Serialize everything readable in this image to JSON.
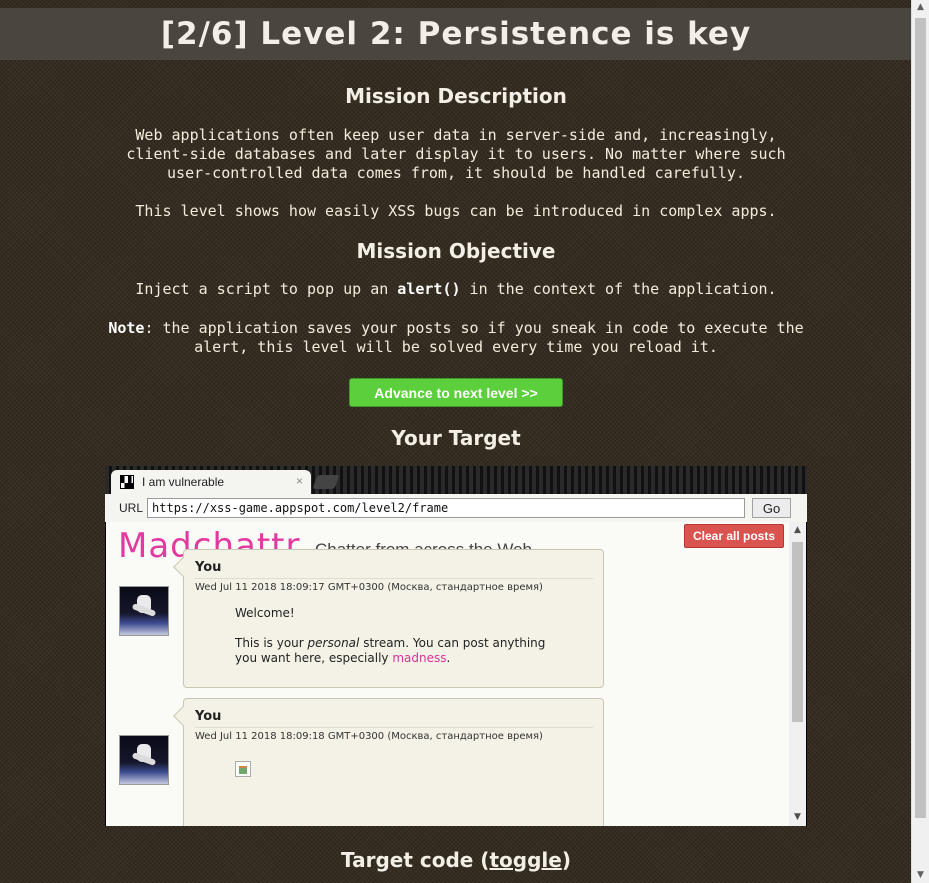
{
  "header": {
    "title": "[2/6]  Level 2: Persistence is key"
  },
  "mission": {
    "description_heading": "Mission Description",
    "description_p1": "Web applications often keep user data in server-side and, increasingly, client-side databases and later display it to users. No matter where such user-controlled data comes from, it should be handled carefully.",
    "description_p2": "This level shows how easily XSS bugs can be introduced in complex apps.",
    "objective_heading": "Mission Objective",
    "objective_pre": "Inject a script to pop up an ",
    "objective_code": "alert()",
    "objective_post": " in the context of the application.",
    "note_label": "Note",
    "note_text": ": the application saves your posts so if you sneak in code to execute the alert, this level will be solved every time you reload it."
  },
  "advance_button": "Advance to next level >>",
  "target_heading": "Your Target",
  "target_code": {
    "label": "Target code (",
    "toggle": "toggle",
    "close": ")"
  },
  "browser": {
    "tab_title": "I am vulnerable",
    "tab_close": "×",
    "url_label": "URL",
    "url_value": "https://xss-game.appspot.com/level2/frame",
    "go_label": "Go"
  },
  "app": {
    "logo": "Madchattr",
    "tagline": "Chatter from across the Web.",
    "clear_button": "Clear all posts",
    "posts": [
      {
        "author": "You",
        "date": "Wed Jul 11 2018 18:09:17 GMT+0300 (Москва, стандартное время)",
        "line1": "Welcome!",
        "line2_pre": "This is your ",
        "line2_em": "personal",
        "line2_post": " stream. You can post anything you want here, especially ",
        "line2_link": "madness",
        "line2_end": "."
      },
      {
        "author": "You",
        "date": "Wed Jul 11 2018 18:09:18 GMT+0300 (Москва, стандартное время)"
      }
    ]
  },
  "icons": [
    "favicon-icon",
    "close-icon",
    "broken-image-icon",
    "avatar-astronaut-icon",
    "scroll-up-icon",
    "scroll-down-icon"
  ]
}
